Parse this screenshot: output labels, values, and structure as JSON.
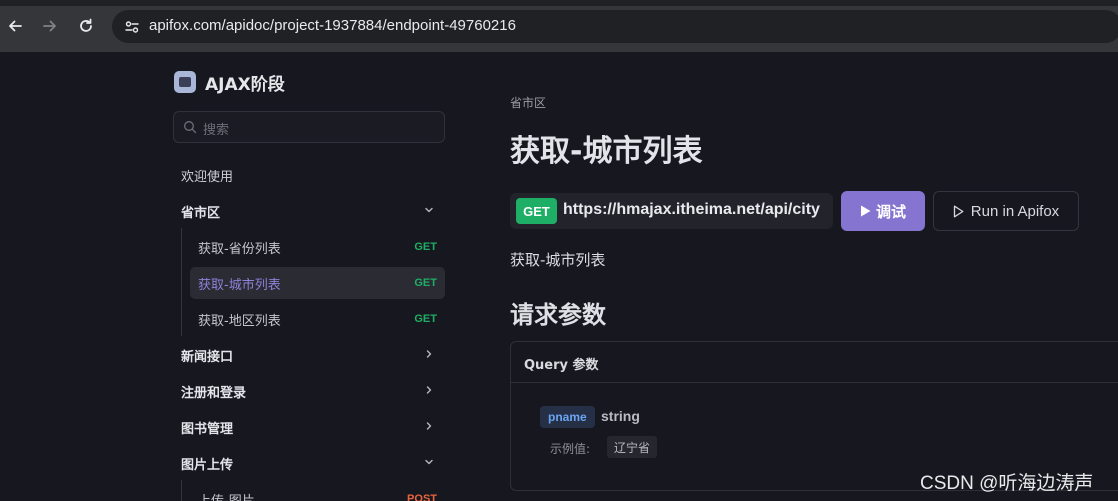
{
  "browser": {
    "url": "apifox.com/apidoc/project-1937884/endpoint-49760216"
  },
  "sidebar": {
    "project_name": "AJAX阶段",
    "search_placeholder": "搜索",
    "items": [
      {
        "label": "欢迎使用",
        "type": "page"
      },
      {
        "label": "省市区",
        "type": "group",
        "expanded": true,
        "children": [
          {
            "label": "获取-省份列表",
            "method": "GET",
            "active": false
          },
          {
            "label": "获取-城市列表",
            "method": "GET",
            "active": true
          },
          {
            "label": "获取-地区列表",
            "method": "GET",
            "active": false
          }
        ]
      },
      {
        "label": "新闻接口",
        "type": "group",
        "expanded": false
      },
      {
        "label": "注册和登录",
        "type": "group",
        "expanded": false
      },
      {
        "label": "图书管理",
        "type": "group",
        "expanded": false
      },
      {
        "label": "图片上传",
        "type": "group",
        "expanded": true,
        "children": [
          {
            "label": "上传-图片",
            "method": "POST",
            "active": false
          }
        ]
      }
    ]
  },
  "main": {
    "breadcrumb": "省市区",
    "title": "获取-城市列表",
    "method": "GET",
    "endpoint_url": "https://hmajax.itheima.net/api/city",
    "debug_label": "调试",
    "run_label": "Run in Apifox",
    "description": "获取-城市列表",
    "section_title": "请求参数",
    "query": {
      "header": "Query 参数",
      "params": [
        {
          "name": "pname",
          "type": "string",
          "example_label": "示例值:",
          "example": "辽宁省"
        }
      ]
    }
  },
  "colors": {
    "get": "#1fae66",
    "post": "#e8643c",
    "accent": "#8575d0",
    "active_text": "#8c82d8"
  },
  "watermark": "CSDN @听海边涛声"
}
